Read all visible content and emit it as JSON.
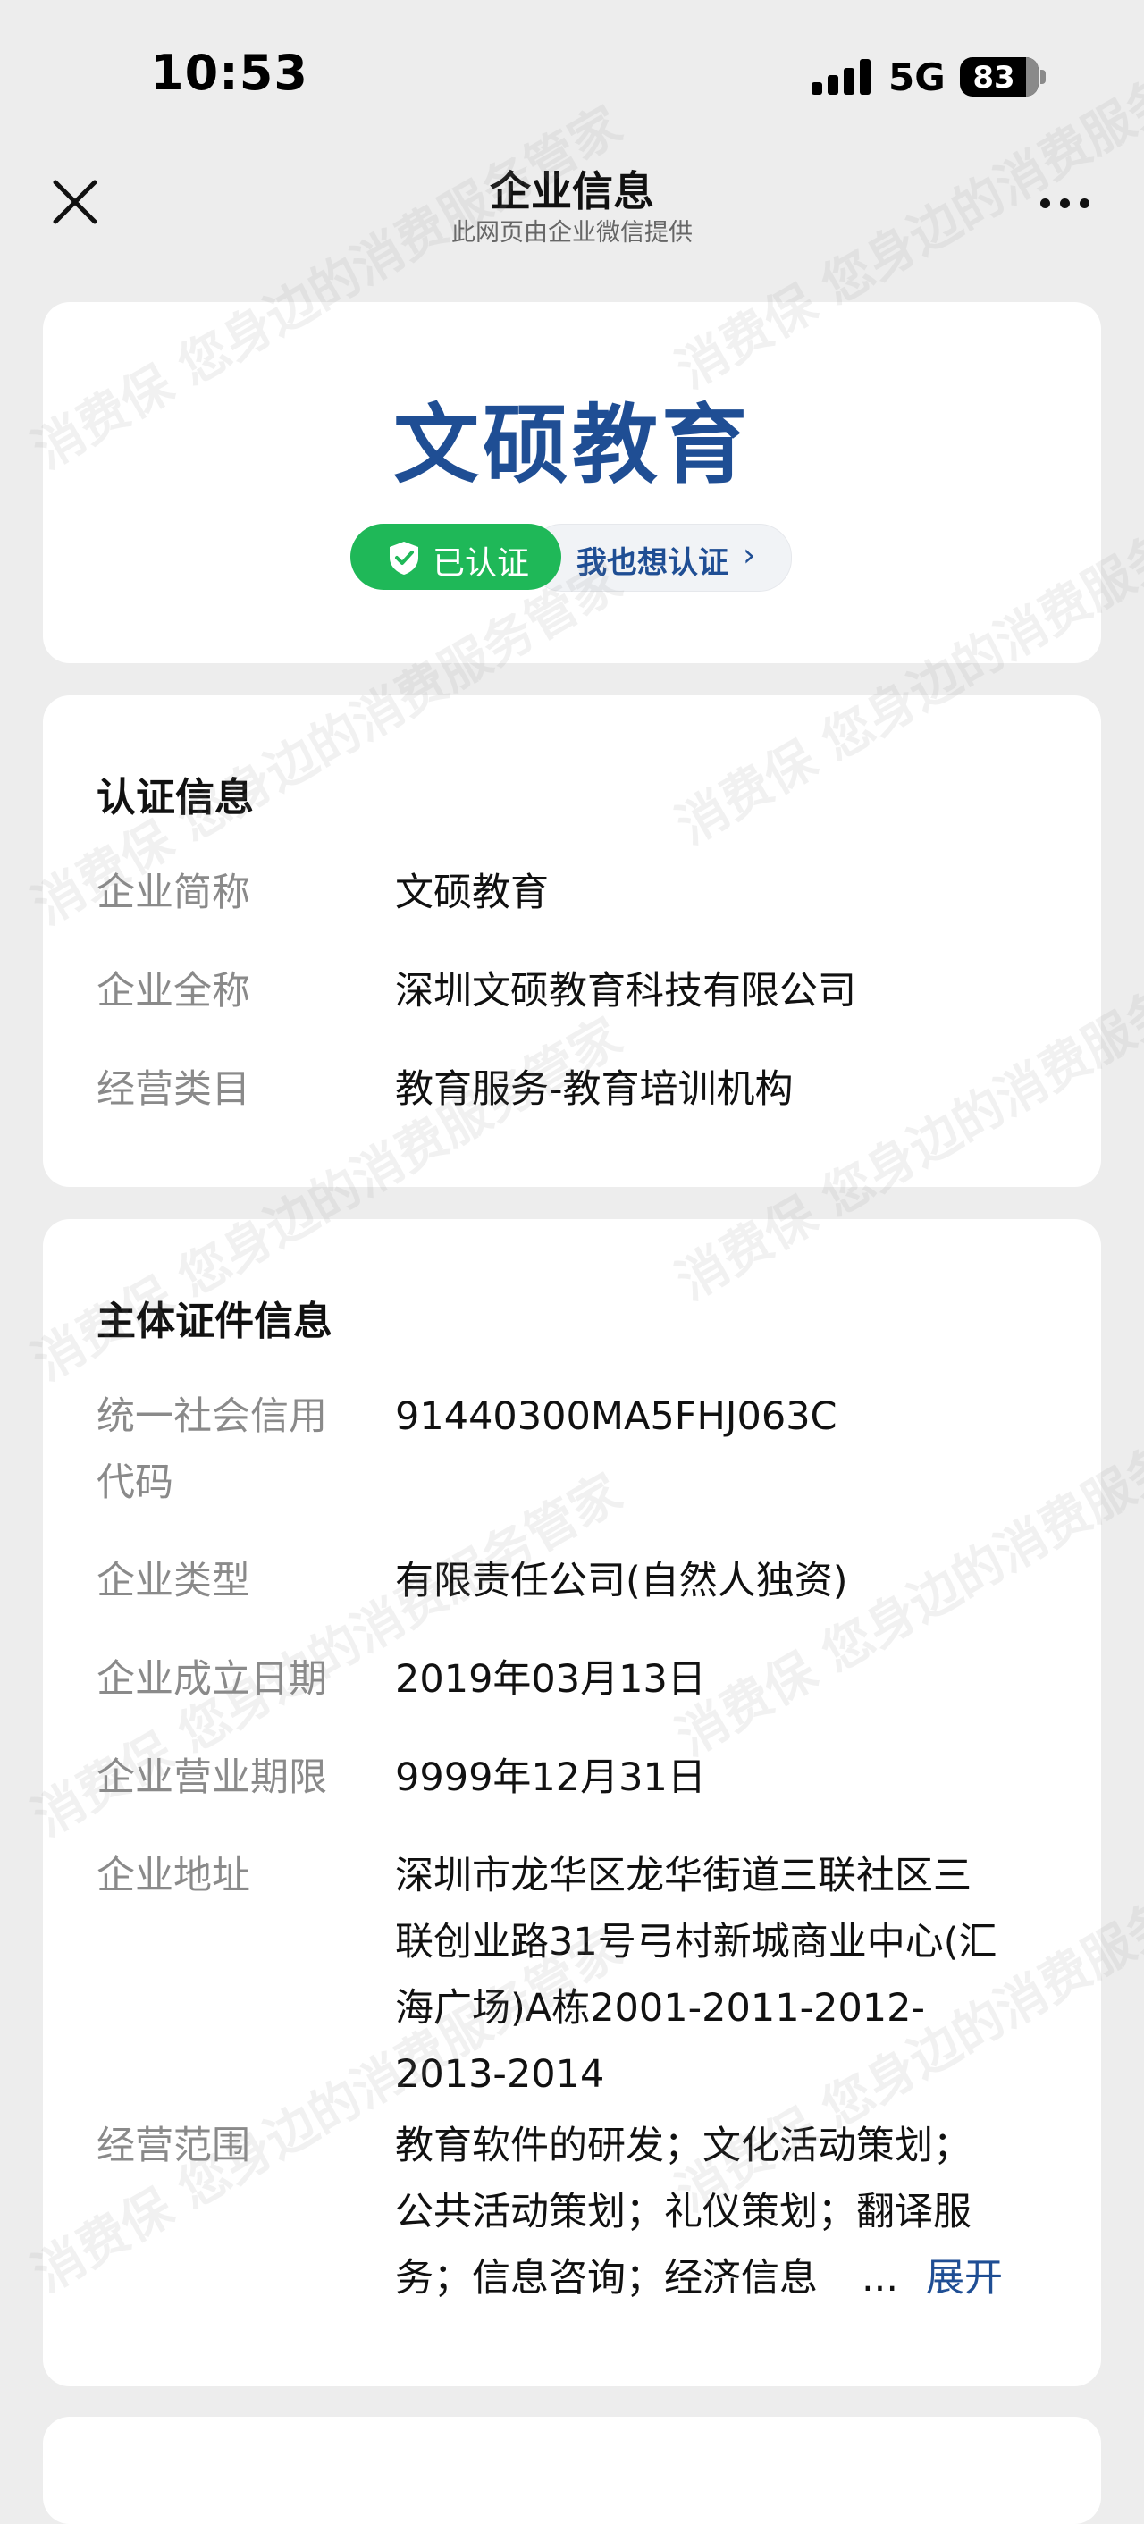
{
  "status_bar": {
    "time": "10:53",
    "network": "5G",
    "battery": "83"
  },
  "nav": {
    "title": "企业信息",
    "subtitle": "此网页由企业微信提供"
  },
  "watermark": {
    "text": "消费保 您身边的消费服务管家"
  },
  "header_card": {
    "company_name": "文硕教育",
    "verified_label": "已认证",
    "want_verify_label": "我也想认证",
    "want_verify_chevron": "›"
  },
  "cert_info": {
    "title": "认证信息",
    "rows": [
      {
        "label": "企业简称",
        "value": "文硕教育"
      },
      {
        "label": "企业全称",
        "value": "深圳文硕教育科技有限公司"
      },
      {
        "label": "经营类目",
        "value": "教育服务-教育培训机构"
      }
    ]
  },
  "license_info": {
    "title": "主体证件信息",
    "rows": [
      {
        "label_line1": "统一社会信用",
        "label_line2": "代码",
        "value": "91440300MA5FHJ063C"
      },
      {
        "label": "企业类型",
        "value": "有限责任公司(自然人独资)"
      },
      {
        "label": "企业成立日期",
        "value": "2019年03月13日"
      },
      {
        "label": "企业营业期限",
        "value": "9999年12月31日"
      },
      {
        "label": "企业地址",
        "value_lines": [
          "深圳市龙华区龙华街道三联社区三",
          "联创业路31号弓村新城商业中心(汇",
          "海广场)A栋2001-2011-2012-",
          "2013-2014"
        ]
      },
      {
        "label": "经营范围",
        "value_lines": [
          "教育软件的研发；文化活动策划；",
          "公共活动策划；礼仪策划；翻译服",
          "务；信息咨询；经济信息"
        ]
      }
    ],
    "ellipsis": "...",
    "expand_label": "展开"
  }
}
